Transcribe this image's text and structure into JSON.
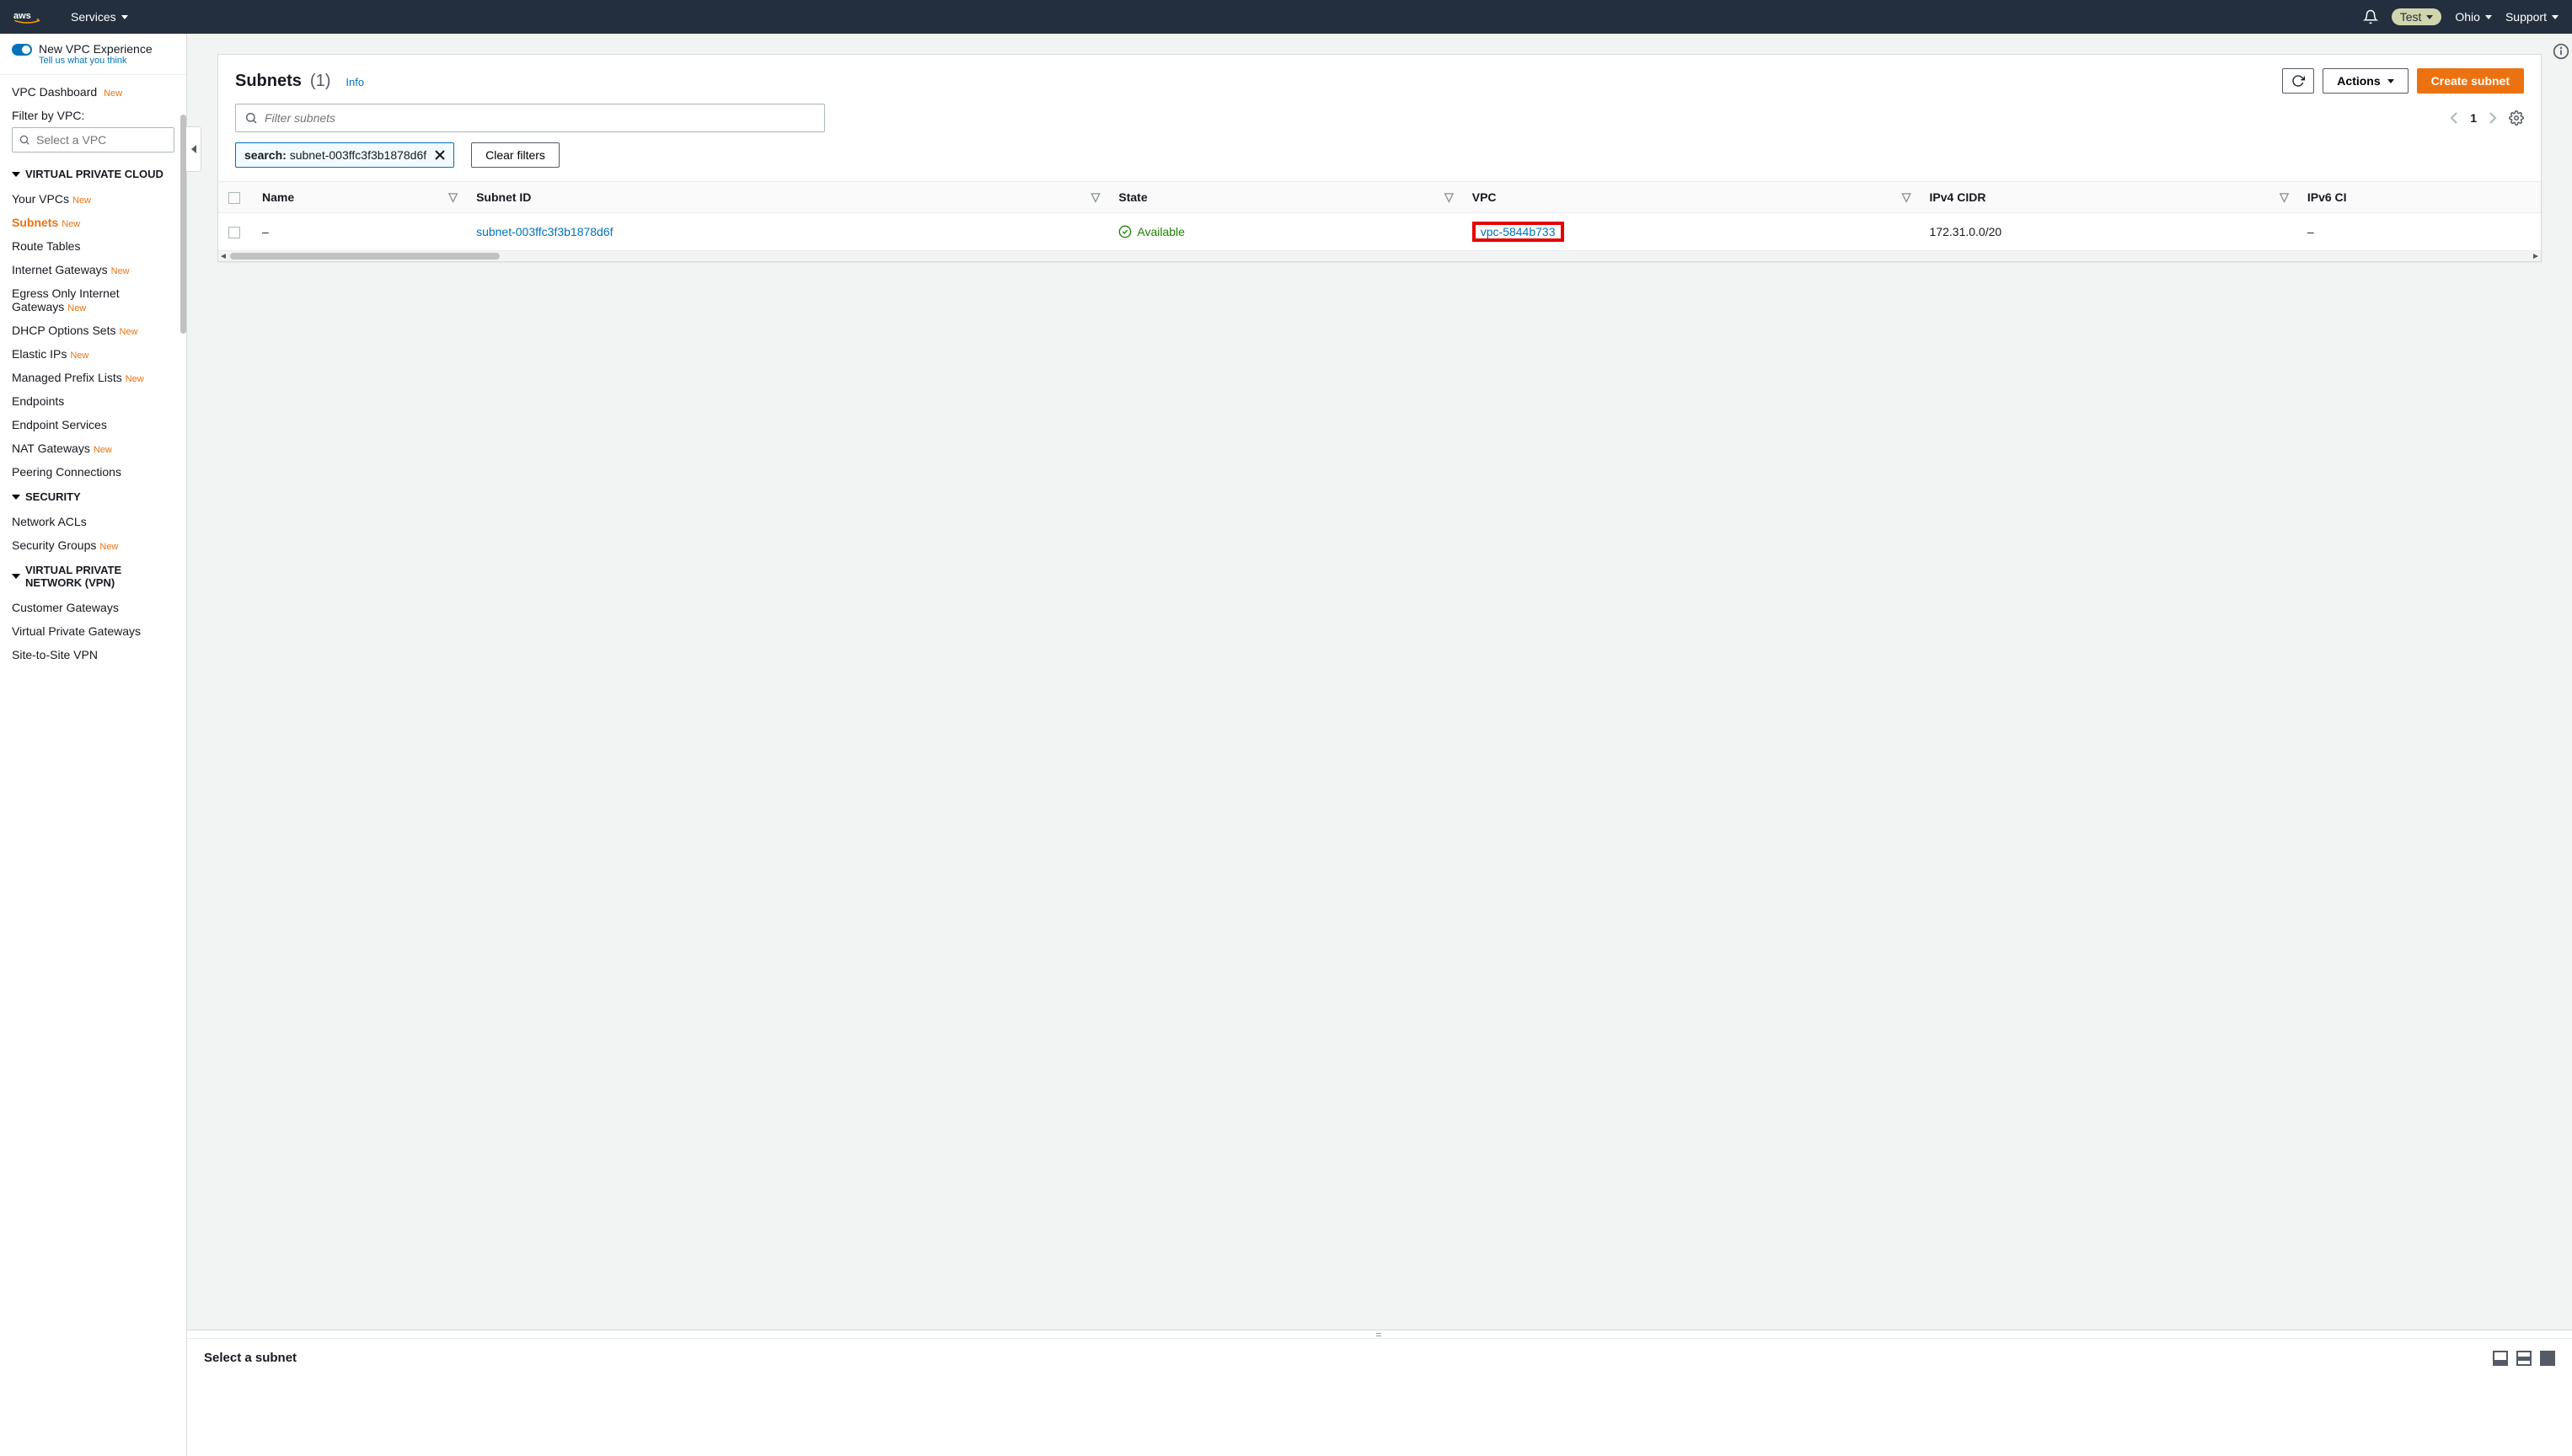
{
  "topnav": {
    "services_label": "Services",
    "account_pill": "Test",
    "region_label": "Ohio",
    "support_label": "Support"
  },
  "sidebar": {
    "experience_label": "New VPC Experience",
    "experience_sublabel": "Tell us what you think",
    "vpc_dashboard": "VPC Dashboard",
    "vpc_dashboard_new": "New",
    "filter_by_label": "Filter by VPC:",
    "filter_placeholder": "Select a VPC",
    "sections": {
      "vpc": {
        "title": "VIRTUAL PRIVATE CLOUD",
        "items": [
          {
            "label": "Your VPCs",
            "new": "New"
          },
          {
            "label": "Subnets",
            "new": "New",
            "active": true
          },
          {
            "label": "Route Tables"
          },
          {
            "label": "Internet Gateways",
            "new": "New"
          },
          {
            "label": "Egress Only Internet Gateways",
            "new": "New"
          },
          {
            "label": "DHCP Options Sets",
            "new": "New"
          },
          {
            "label": "Elastic IPs",
            "new": "New"
          },
          {
            "label": "Managed Prefix Lists",
            "new": "New"
          },
          {
            "label": "Endpoints"
          },
          {
            "label": "Endpoint Services"
          },
          {
            "label": "NAT Gateways",
            "new": "New"
          },
          {
            "label": "Peering Connections"
          }
        ]
      },
      "security": {
        "title": "SECURITY",
        "items": [
          {
            "label": "Network ACLs"
          },
          {
            "label": "Security Groups",
            "new": "New"
          }
        ]
      },
      "vpn": {
        "title": "VIRTUAL PRIVATE NETWORK (VPN)",
        "items": [
          {
            "label": "Customer Gateways"
          },
          {
            "label": "Virtual Private Gateways"
          },
          {
            "label": "Site-to-Site VPN"
          }
        ]
      }
    }
  },
  "main": {
    "title": "Subnets",
    "count": "(1)",
    "info_label": "Info",
    "actions_label": "Actions",
    "create_label": "Create subnet",
    "search_placeholder": "Filter subnets",
    "page_num": "1",
    "chip_key": "search:",
    "chip_value": "subnet-003ffc3f3b1878d6f",
    "clear_filters": "Clear filters",
    "columns": {
      "name": "Name",
      "subnet_id": "Subnet ID",
      "state": "State",
      "vpc": "VPC",
      "ipv4": "IPv4 CIDR",
      "ipv6": "IPv6 CI"
    },
    "row": {
      "name": "–",
      "subnet_id": "subnet-003ffc3f3b1878d6f",
      "state": "Available",
      "vpc": "vpc-5844b733",
      "ipv4": "172.31.0.0/20",
      "ipv6": "–"
    },
    "bottom_title": "Select a subnet"
  }
}
